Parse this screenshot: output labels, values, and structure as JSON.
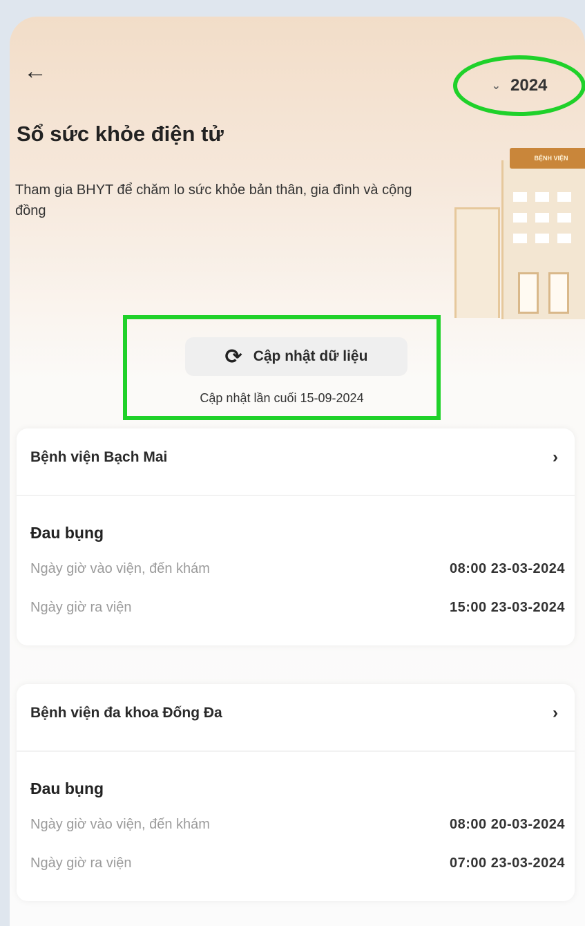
{
  "header": {
    "back_icon": "arrow-left-icon",
    "year": "2024",
    "title": "Sổ sức khỏe điện tử",
    "description": "Tham gia BHYT để chăm lo sức khỏe bản thân, gia đình và cộng đồng",
    "illustration_sign": "BỆNH VIỆN"
  },
  "sync": {
    "button_label": "Cập nhật dữ liệu",
    "last_updated": "Cập nhật lần cuối 15-09-2024"
  },
  "visits": [
    {
      "hospital": "Bệnh viện Bạch Mai",
      "diagnosis": "Đau bụng",
      "admit_label": "Ngày giờ vào viện, đến khám",
      "admit_value": "08:00 23-03-2024",
      "discharge_label": "Ngày giờ ra viện",
      "discharge_value": "15:00 23-03-2024"
    },
    {
      "hospital": "Bệnh viện đa khoa Đống Đa",
      "diagnosis": "Đau bụng",
      "admit_label": "Ngày giờ vào viện, đến khám",
      "admit_value": "08:00 20-03-2024",
      "discharge_label": "Ngày giờ ra viện",
      "discharge_value": "07:00 23-03-2024"
    }
  ],
  "colors": {
    "highlight": "#1fd12a",
    "header_gradient_top": "#f2ddc8"
  }
}
